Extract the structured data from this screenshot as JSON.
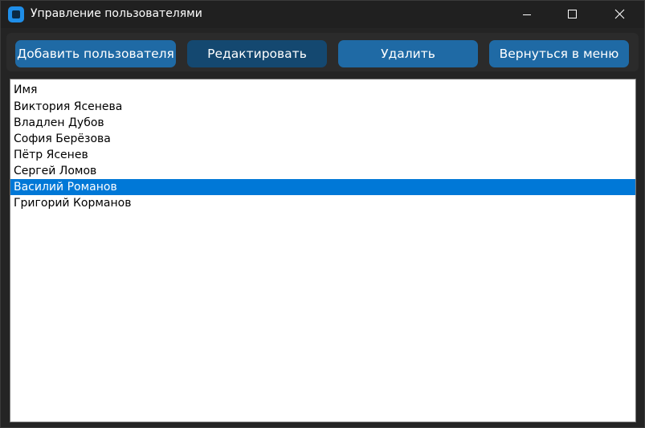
{
  "window": {
    "title": "Управление пользователями"
  },
  "toolbar": {
    "add_label": "Добавить пользователя",
    "edit_label": "Редактировать",
    "delete_label": "Удалить",
    "back_label": "Вернуться в меню"
  },
  "users_list": {
    "header": "Имя",
    "selected_index": 5,
    "rows": [
      "Виктория Ясенева",
      "Владлен Дубов",
      "София Берёзова",
      "Пётр Ясенев",
      "Сергей Ломов",
      "Василий Романов",
      "Григорий Корманов"
    ]
  },
  "colors": {
    "window_bg": "#242424",
    "button": "#1f6aa5",
    "button_hover": "#144870",
    "selection": "#0078d7"
  },
  "icons": {
    "app": "app-icon",
    "minimize": "minimize-icon",
    "maximize": "maximize-icon",
    "close": "close-icon"
  }
}
